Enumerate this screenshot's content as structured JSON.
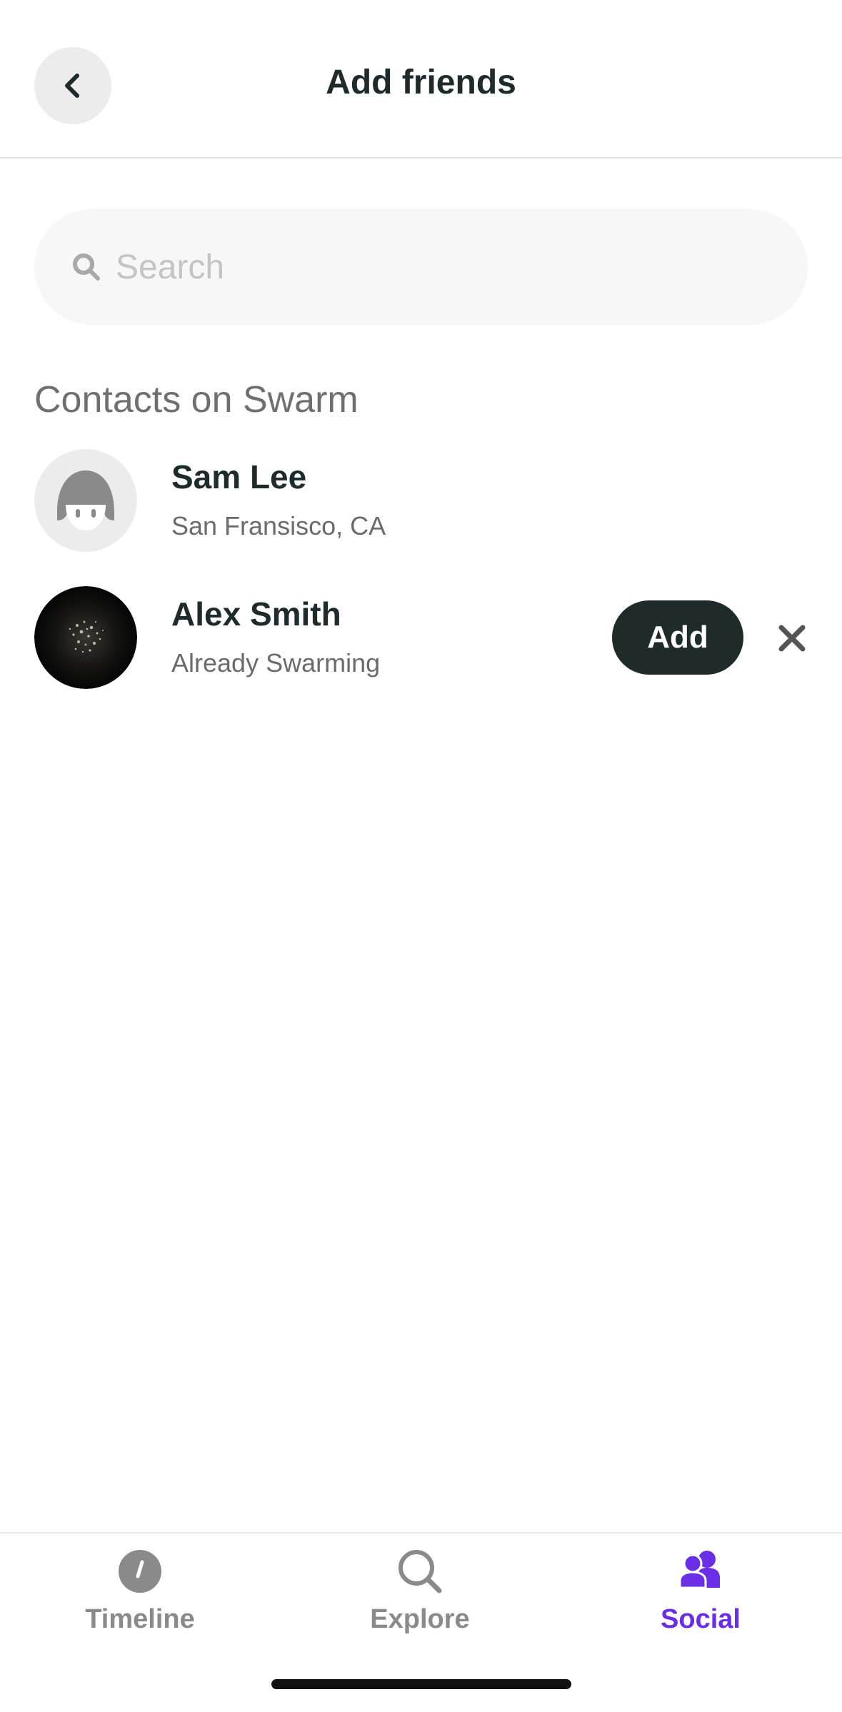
{
  "header": {
    "title": "Add friends",
    "back_icon": "chevron-left-icon"
  },
  "search": {
    "placeholder": "Search",
    "value": "",
    "icon": "search-icon"
  },
  "contacts_section": {
    "title": "Contacts on Swarm",
    "contacts": [
      {
        "name": "Sam Lee",
        "subtitle": "San Fransisco, CA",
        "avatar": "default-avatar-icon",
        "actions": []
      },
      {
        "name": "Alex Smith",
        "subtitle": "Already Swarming",
        "avatar": "photo-avatar",
        "actions": [
          "Add",
          "dismiss"
        ],
        "add_label": "Add"
      }
    ]
  },
  "tabbar": {
    "tabs": [
      {
        "label": "Timeline",
        "icon": "clock-icon",
        "active": false
      },
      {
        "label": "Explore",
        "icon": "search-icon",
        "active": false
      },
      {
        "label": "Social",
        "icon": "people-icon",
        "active": true
      }
    ]
  },
  "colors": {
    "accent": "#6a2ee6",
    "primary_text": "#1f2a2b",
    "secondary_text": "#6b6b6b",
    "button_dark": "#1f2a2b",
    "search_bg": "#f7f7f7"
  }
}
